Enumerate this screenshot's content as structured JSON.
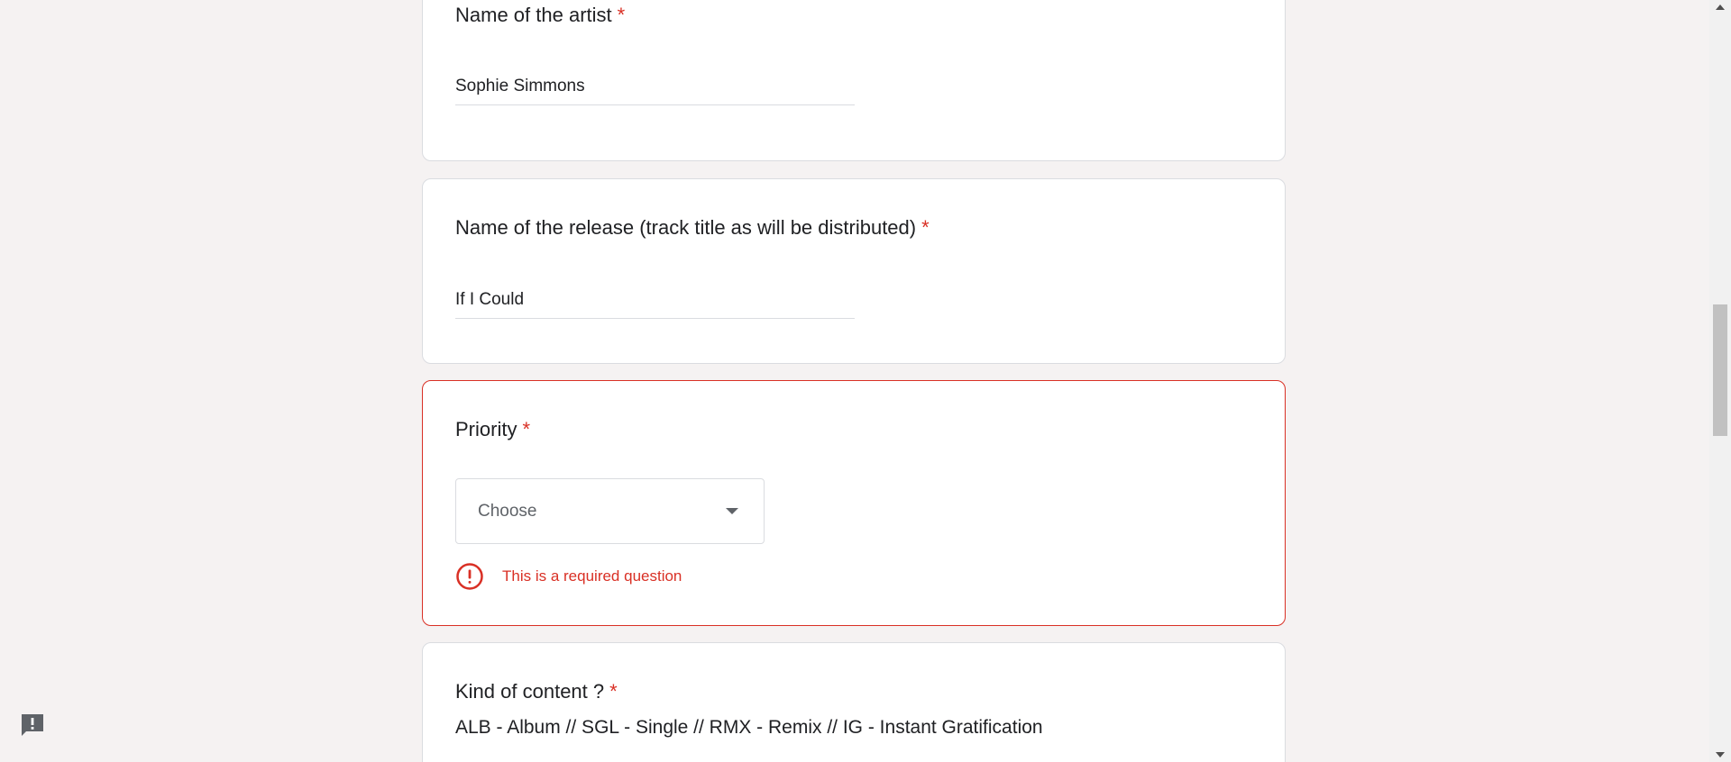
{
  "questions": [
    {
      "title": "Name of the artist",
      "required_mark": "*",
      "answer": "Sophie Simmons"
    },
    {
      "title": "Name of the release (track title as will be distributed)",
      "required_mark": "*",
      "answer": "If I Could"
    },
    {
      "title": "Priority",
      "required_mark": "*",
      "dropdown_placeholder": "Choose",
      "error": "This is a required question"
    },
    {
      "title": "Kind of content ?",
      "required_mark": "*",
      "description": "ALB - Album // SGL - Single // RMX - Remix // IG - Instant Gratification"
    }
  ],
  "icons": {
    "error": "error-circle-icon",
    "dropdown": "arrow-drop-down-icon",
    "feedback": "report-feedback-icon"
  },
  "colors": {
    "background": "#f5f2f2",
    "card": "#ffffff",
    "error": "#d93025",
    "text": "#202124",
    "border": "#dadce0"
  }
}
